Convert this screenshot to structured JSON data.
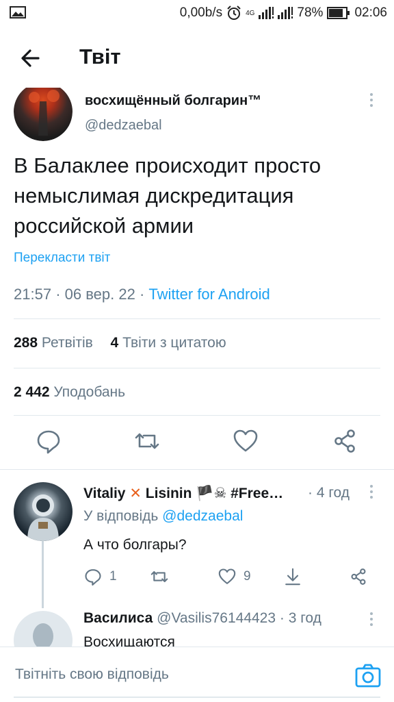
{
  "status_bar": {
    "network_speed": "0,00b/s",
    "network_type": "4G",
    "battery": "78%",
    "time": "02:06"
  },
  "app_bar": {
    "title": "Твіт"
  },
  "tweet": {
    "author_name": "восхищённый болгарин™",
    "author_handle": "@dedzaebal",
    "text": "В Балаклее происходит просто немыслимая дискредитация российской армии",
    "translate_label": "Перекласти твіт",
    "time": "21:57",
    "date": "06 вер. 22",
    "source": "Twitter for Android",
    "retweets_count": "288",
    "retweets_label": "Ретвітів",
    "quotes_count": "4",
    "quotes_label": "Твіти з цитатою",
    "likes_count": "2 442",
    "likes_label": "Уподобань"
  },
  "replies": [
    {
      "name_part1": "Vitaliy",
      "name_x": "✕",
      "name_part2": "Lisinin",
      "name_flag": "🏴",
      "name_skull": "☠",
      "name_tail": "#Free…",
      "time": "· 4 год",
      "reply_prefix": "У відповідь",
      "reply_to": "@dedzaebal",
      "text": "А что болгары?",
      "reply_count": "1",
      "like_count": "9"
    },
    {
      "name": "Василиса",
      "handle": "@Vasilis76144423",
      "time": "· 3 год",
      "text": "Восхищаются"
    }
  ],
  "composer": {
    "placeholder": "Твітніть свою відповідь"
  },
  "colors": {
    "accent": "#1da1f2",
    "secondary_text": "#657786",
    "divider": "#e1e8ed"
  }
}
